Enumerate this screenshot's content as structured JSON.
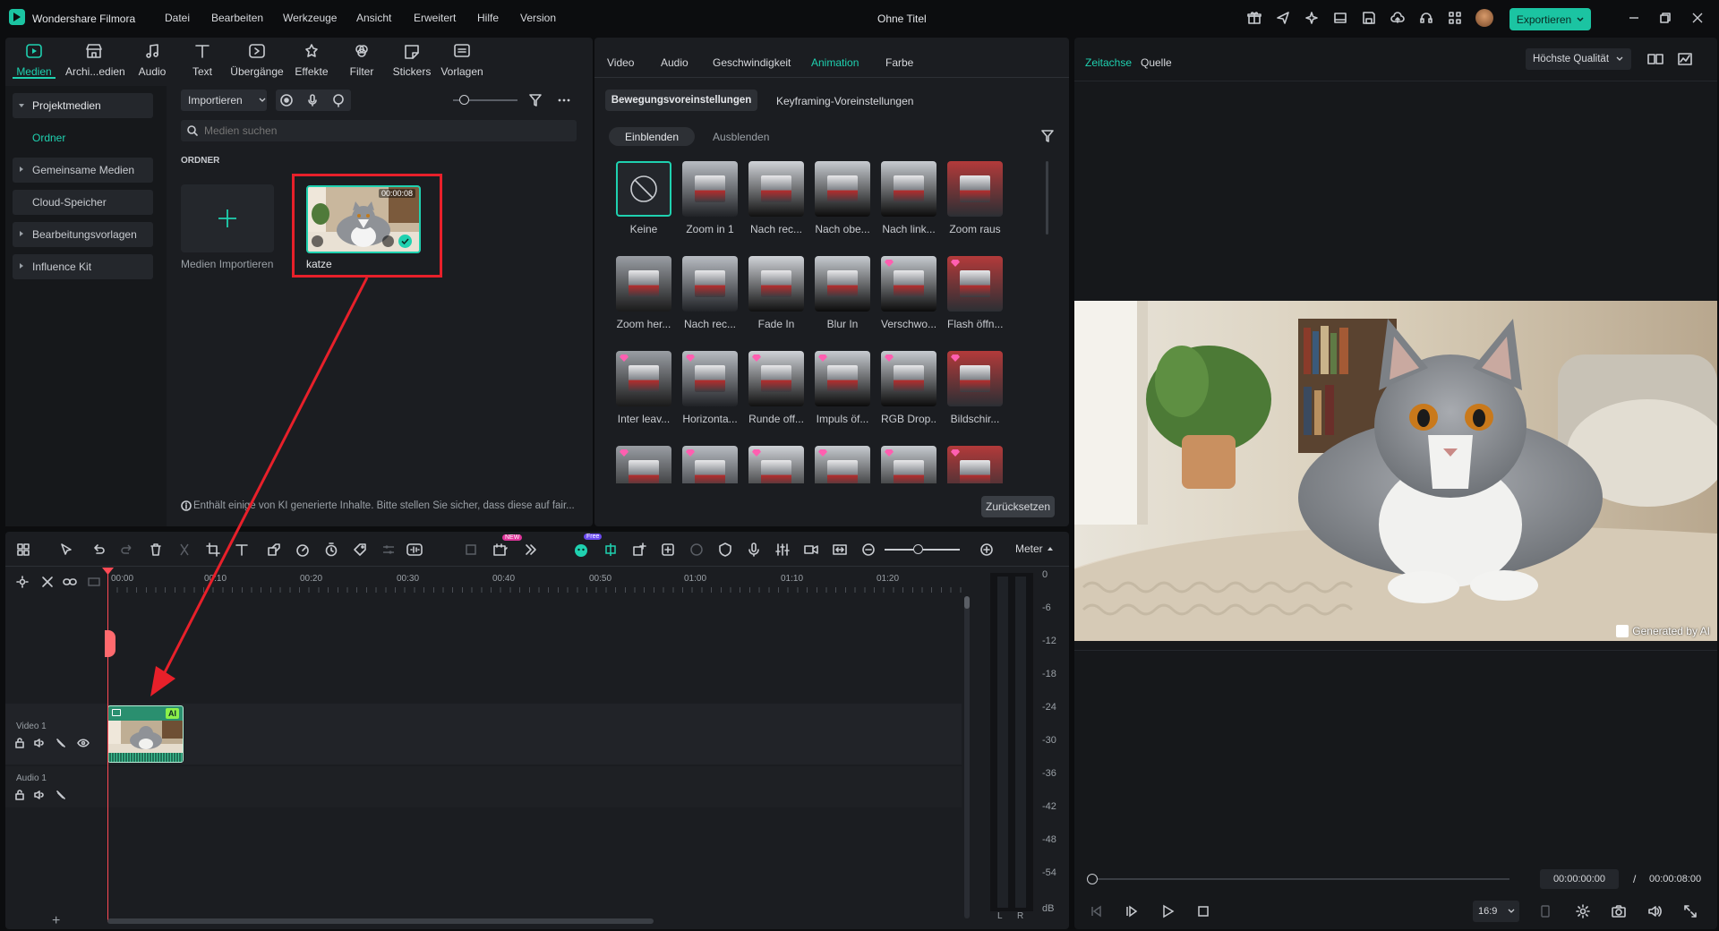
{
  "app": {
    "name": "Wondershare Filmora",
    "document_title": "Ohne Titel",
    "menu": [
      "Datei",
      "Bearbeiten",
      "Werkzeuge",
      "Ansicht",
      "Erweitert",
      "Hilfe",
      "Version"
    ],
    "export_label": "Exportieren"
  },
  "media_toolbar": {
    "tabs": [
      "Medien",
      "Archi...edien",
      "Audio",
      "Text",
      "Übergänge",
      "Effekte",
      "Filter",
      "Stickers",
      "Vorlagen"
    ],
    "active_tab": "Medien"
  },
  "media_sidebar": {
    "items": [
      "Projektmedien",
      "Ordner",
      "Gemeinsame Medien",
      "Cloud-Speicher",
      "Bearbeitungsvorlagen",
      "Influence Kit"
    ]
  },
  "media_bin": {
    "import_label": "Importieren",
    "search_placeholder": "Medien suchen",
    "folder_heading": "ORDNER",
    "import_tile_label": "Medien Importieren",
    "clip_name": "katze",
    "clip_duration": "00:00:08",
    "ai_notice": "Enthält einige von KI generierte Inhalte. Bitte stellen Sie sicher, dass diese auf fair..."
  },
  "properties": {
    "tabs": [
      "Video",
      "Audio",
      "Geschwindigkeit",
      "Animation",
      "Farbe"
    ],
    "active_tab": "Animation",
    "subtabs": [
      "Bewegungsvoreinstellungen",
      "Keyframing-Voreinstellungen"
    ],
    "modes": [
      "Einblenden",
      "Ausblenden"
    ],
    "reset_label": "Zurücksetzen",
    "presets": [
      "Keine",
      "Zoom in 1",
      "Nach rec...",
      "Nach obe...",
      "Nach link...",
      "Zoom raus",
      "Zoom her...",
      "Nach rec...",
      "Fade In",
      "Blur In",
      "Verschwo...",
      "Flash öffn...",
      "Inter leav...",
      "Horizonta...",
      "Runde off...",
      "Impuls öf...",
      "RGB Drop...",
      "Bildschir..."
    ]
  },
  "preview": {
    "tabs": [
      "Zeitachse",
      "Quelle"
    ],
    "quality": "Höchste Qualität",
    "watermark": "Generated by AI",
    "current_time": "00:00:00:00",
    "time_separator": "/",
    "total_time": "00:00:08:00",
    "aspect": "16:9",
    "progress": 0.0
  },
  "timeline": {
    "meter_label": "Meter",
    "ruler": [
      "00:00",
      "00:10",
      "00:20",
      "00:30",
      "00:40",
      "00:50",
      "01:00",
      "01:10",
      "01:20"
    ],
    "tracks": [
      "Video 1",
      "Audio 1"
    ],
    "clip_badge": "AI",
    "new_badge": "NEW",
    "free_badge": "Free",
    "meter_scale": [
      "0",
      "-6",
      "-12",
      "-18",
      "-24",
      "-30",
      "-36",
      "-42",
      "-48",
      "-54",
      "dB"
    ],
    "meter_channels": [
      "L",
      "R"
    ],
    "add_track": "+"
  },
  "colors": {
    "accent": "#1fd1b0",
    "highlight_box": "#e8202a",
    "playhead": "#ff4a55",
    "clip_green": "#2a8f6f"
  }
}
